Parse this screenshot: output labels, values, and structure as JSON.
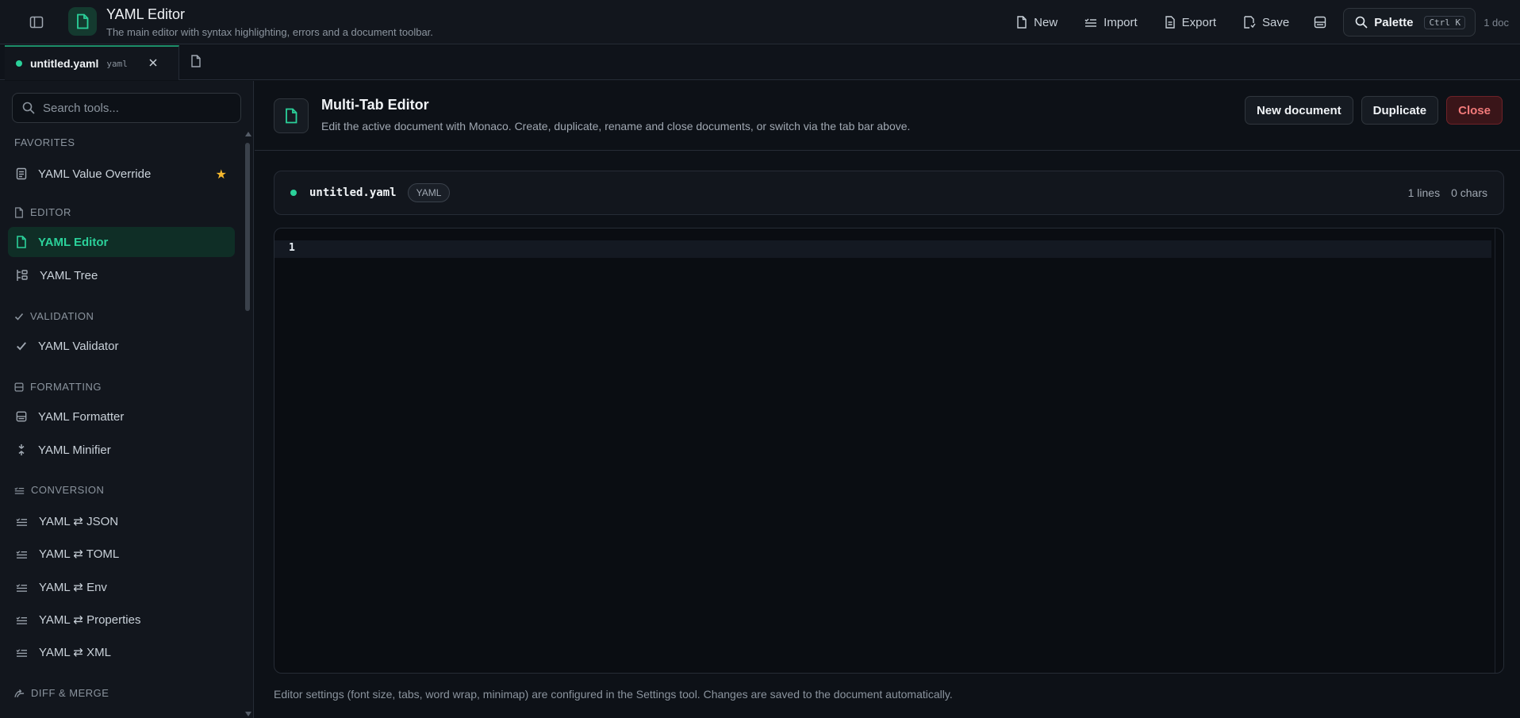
{
  "header": {
    "title": "YAML Editor",
    "subtitle": "The main editor with syntax highlighting, errors and a document toolbar.",
    "actions": {
      "new": "New",
      "import": "Import",
      "export": "Export",
      "save": "Save"
    },
    "palette_label": "Palette",
    "palette_shortcut": "Ctrl K",
    "doc_count": "1 doc"
  },
  "tabs": [
    {
      "name": "untitled.yaml",
      "lang": "yaml"
    }
  ],
  "sidebar": {
    "search_placeholder": "Search tools...",
    "sections": [
      {
        "label": "FAVORITES",
        "items": [
          {
            "label": "YAML Value Override",
            "favorite": true
          }
        ]
      },
      {
        "label": "EDITOR",
        "items": [
          {
            "label": "YAML Editor",
            "active": true
          },
          {
            "label": "YAML Tree"
          }
        ]
      },
      {
        "label": "VALIDATION",
        "items": [
          {
            "label": "YAML Validator"
          }
        ]
      },
      {
        "label": "FORMATTING",
        "items": [
          {
            "label": "YAML Formatter"
          },
          {
            "label": "YAML Minifier"
          }
        ]
      },
      {
        "label": "CONVERSION",
        "items": [
          {
            "label": "YAML ⇄ JSON"
          },
          {
            "label": "YAML ⇄ TOML"
          },
          {
            "label": "YAML ⇄ Env"
          },
          {
            "label": "YAML ⇄ Properties"
          },
          {
            "label": "YAML ⇄ XML"
          }
        ]
      },
      {
        "label": "DIFF & MERGE",
        "items": []
      }
    ]
  },
  "tool": {
    "title": "Multi-Tab Editor",
    "description": "Edit the active document with Monaco. Create, duplicate, rename and close documents, or switch via the tab bar above.",
    "buttons": {
      "new_document": "New document",
      "duplicate": "Duplicate",
      "close": "Close"
    }
  },
  "document": {
    "name": "untitled.yaml",
    "badge": "YAML",
    "lines": "1 lines",
    "chars": "0 chars",
    "line_number": "1"
  },
  "footer_note": "Editor settings (font size, tabs, word wrap, minimap) are configured in the Settings tool. Changes are saved to the document automatically.",
  "colors": {
    "accent": "#2bd19a",
    "favorite": "#f5b82e",
    "danger": "#f27a7a"
  }
}
